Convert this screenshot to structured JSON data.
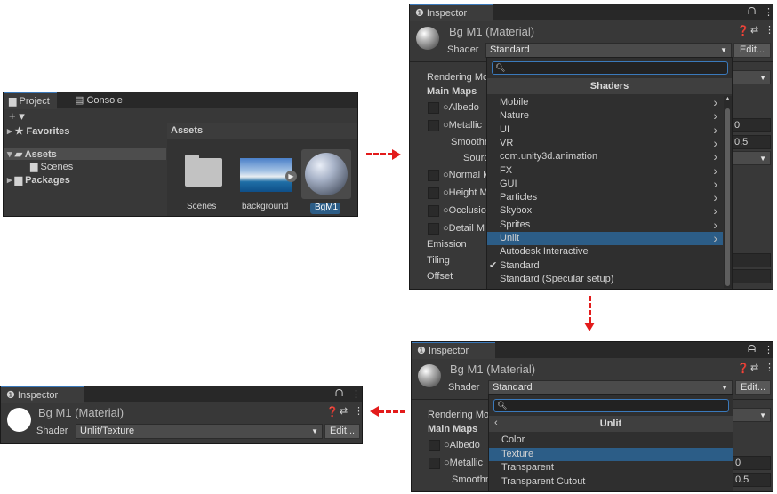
{
  "project": {
    "tab_project": "Project",
    "tab_console": "Console",
    "add": "+ ▾",
    "favorites": "Favorites",
    "assets": "Assets",
    "scenes": "Scenes",
    "packages": "Packages",
    "breadcrumb": "Assets",
    "items": [
      {
        "label": "Scenes"
      },
      {
        "label": "background"
      },
      {
        "label": "BgM1"
      }
    ]
  },
  "inspector1": {
    "tab": "Inspector",
    "material": "Bg M1 (Material)",
    "shader_label": "Shader",
    "shader_value": "Standard",
    "edit": "Edit...",
    "props": [
      "Rendering Mo",
      "Main Maps",
      "Albedo",
      "Metallic",
      "Smoothn",
      "Sourc",
      "Normal M",
      "Height M",
      "Occlusio",
      "Detail M",
      "Emission",
      "Tiling",
      "Offset"
    ],
    "values": [
      "0",
      "0.5"
    ],
    "popup_title": "Shaders",
    "menu": [
      {
        "label": "Mobile",
        "sub": true
      },
      {
        "label": "Nature",
        "sub": true
      },
      {
        "label": "UI",
        "sub": true
      },
      {
        "label": "VR",
        "sub": true
      },
      {
        "label": "com.unity3d.animation",
        "sub": true
      },
      {
        "label": "FX",
        "sub": true
      },
      {
        "label": "GUI",
        "sub": true
      },
      {
        "label": "Particles",
        "sub": true
      },
      {
        "label": "Skybox",
        "sub": true
      },
      {
        "label": "Sprites",
        "sub": true
      },
      {
        "label": "Unlit",
        "sub": true,
        "selected": true
      },
      {
        "label": "Autodesk Interactive",
        "sub": false
      },
      {
        "label": "Standard",
        "sub": false,
        "checked": true
      },
      {
        "label": "Standard (Specular setup)",
        "sub": false
      }
    ]
  },
  "inspector2": {
    "tab": "Inspector",
    "material": "Bg M1 (Material)",
    "shader_label": "Shader",
    "shader_value": "Standard",
    "edit": "Edit...",
    "props": [
      "Rendering Mo",
      "Main Maps",
      "Albedo",
      "Metallic",
      "Smoothn"
    ],
    "values": [
      "0",
      "0.5"
    ],
    "popup_title": "Unlit",
    "menu": [
      {
        "label": "Color"
      },
      {
        "label": "Texture",
        "selected": true
      },
      {
        "label": "Transparent"
      },
      {
        "label": "Transparent Cutout"
      }
    ]
  },
  "inspector3": {
    "tab": "Inspector",
    "material": "Bg M1 (Material)",
    "shader_label": "Shader",
    "shader_value": "Unlit/Texture",
    "edit": "Edit..."
  },
  "colors": {
    "selection": "#2c5d87",
    "arrow": "#e31b1b",
    "panel": "#383838",
    "tabbar": "#282828"
  }
}
